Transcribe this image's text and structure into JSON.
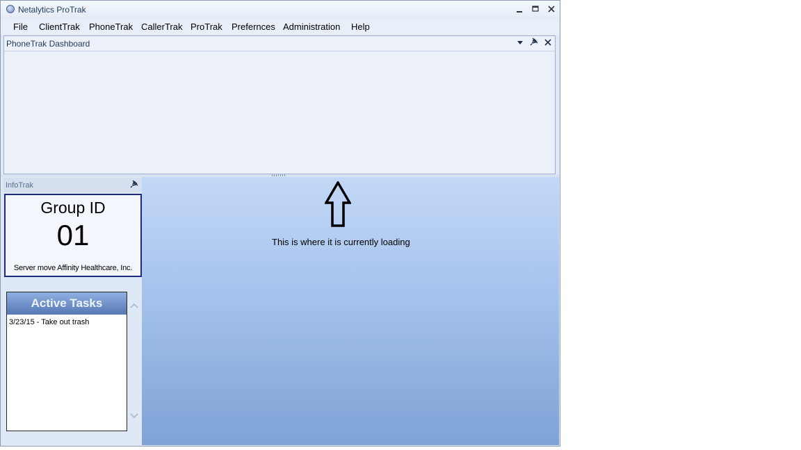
{
  "window": {
    "title": "Netalytics ProTrak"
  },
  "menu": [
    "File",
    "ClientTrak",
    "PhoneTrak",
    "CallerTrak",
    "ProTrak",
    "Prefernces",
    "Administration",
    "Help"
  ],
  "dashboard": {
    "title": "PhoneTrak Dashboard"
  },
  "infotrak": {
    "title": "InfoTrak",
    "group_label": "Group ID",
    "group_id": "01",
    "group_name": "Server move Affinity Healthcare, Inc."
  },
  "tasks": {
    "title": "Active Tasks",
    "items": [
      "3/23/15 - Take out trash"
    ]
  },
  "annotation": {
    "text": "This is where it is currently loading"
  }
}
